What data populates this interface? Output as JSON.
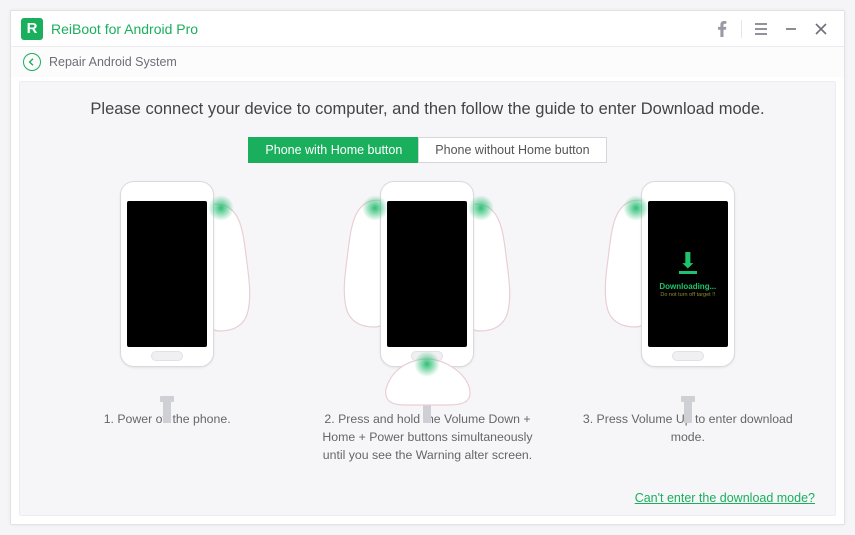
{
  "titlebar": {
    "app_name": "ReiBoot for Android Pro",
    "logo_letter": "R"
  },
  "subheader": {
    "title": "Repair Android System"
  },
  "main": {
    "headline": "Please connect your device to computer, and then follow the guide to enter Download mode.",
    "tabs": {
      "with_home": "Phone with Home button",
      "without_home": "Phone without Home button"
    },
    "steps": {
      "s1": "1. Power off the phone.",
      "s2": "2. Press and hold the Volume Down + Home + Power buttons simultaneously until you see the Warning alter screen.",
      "s3": "3. Press Volume Up to enter download mode."
    },
    "download_screen": {
      "title": "Downloading...",
      "subtitle": "Do not turn off target !!"
    },
    "help_link": "Can't enter the download mode?"
  },
  "colors": {
    "accent": "#1aaf5d"
  }
}
